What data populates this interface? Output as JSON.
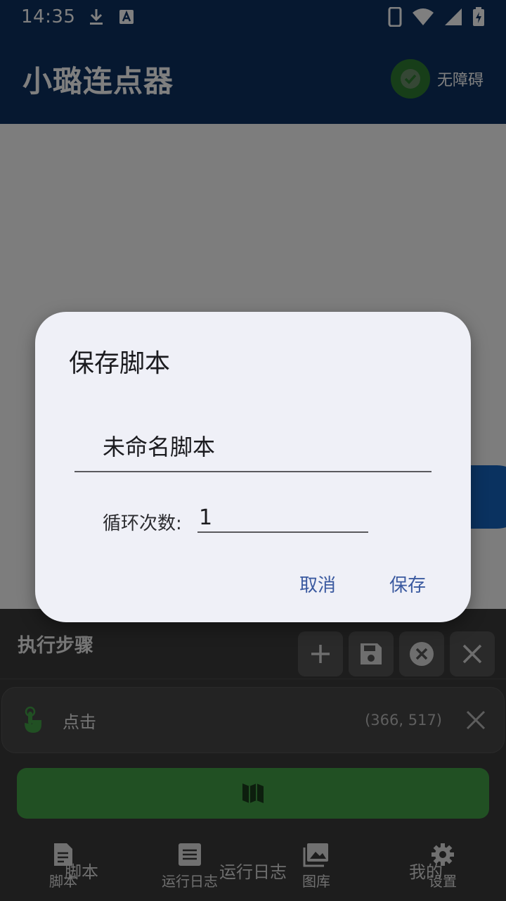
{
  "status_bar": {
    "time": "14:35"
  },
  "app_bar": {
    "title": "小璐连点器",
    "accessibility_label": "无障碍"
  },
  "panel": {
    "title": "执行步骤",
    "step": {
      "label": "点击",
      "coords": "(366, 517)"
    }
  },
  "ghost_nav": {
    "left": "脚本",
    "mid": "运行日志",
    "right": "我的"
  },
  "bottom_nav": {
    "items": [
      {
        "label": "脚本",
        "icon": "document-icon"
      },
      {
        "label": "运行日志",
        "icon": "list-icon"
      },
      {
        "label": "图库",
        "icon": "gallery-icon"
      },
      {
        "label": "设置",
        "icon": "gear-icon"
      }
    ]
  },
  "dialog": {
    "title": "保存脚本",
    "name_value": "未命名脚本",
    "loop_label": "循环次数:",
    "loop_value": "1",
    "cancel_label": "取消",
    "save_label": "保存"
  },
  "colors": {
    "app_bar": "#0d3060",
    "dialog_bg": "#eff0f7",
    "accent": "#3b5aa0",
    "run_bar": "#43a047",
    "a11y_badge": "#2e7d32"
  }
}
